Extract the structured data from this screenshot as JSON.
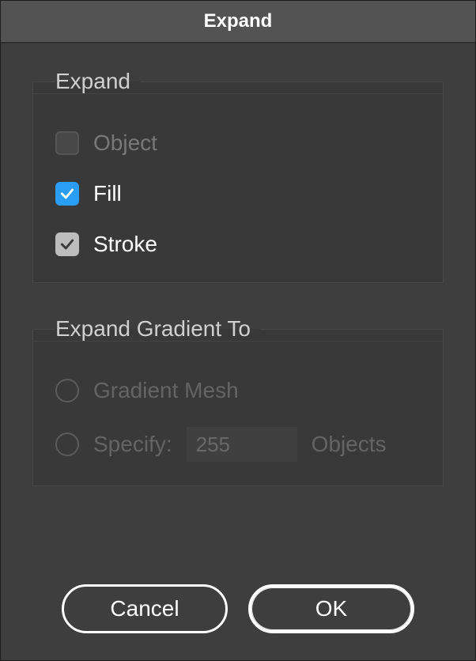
{
  "dialog": {
    "title": "Expand"
  },
  "groups": {
    "expand": {
      "legend": "Expand",
      "object": {
        "label": "Object",
        "checked": false,
        "enabled": false
      },
      "fill": {
        "label": "Fill",
        "checked": true,
        "enabled": true
      },
      "stroke": {
        "label": "Stroke",
        "checked": true,
        "enabled": true
      }
    },
    "gradient": {
      "legend": "Expand Gradient To",
      "mesh": {
        "label": "Gradient Mesh",
        "selected": false,
        "enabled": false
      },
      "specify": {
        "label": "Specify:",
        "selected": false,
        "enabled": false,
        "value": "255",
        "suffix": "Objects"
      }
    }
  },
  "buttons": {
    "cancel": "Cancel",
    "ok": "OK"
  }
}
